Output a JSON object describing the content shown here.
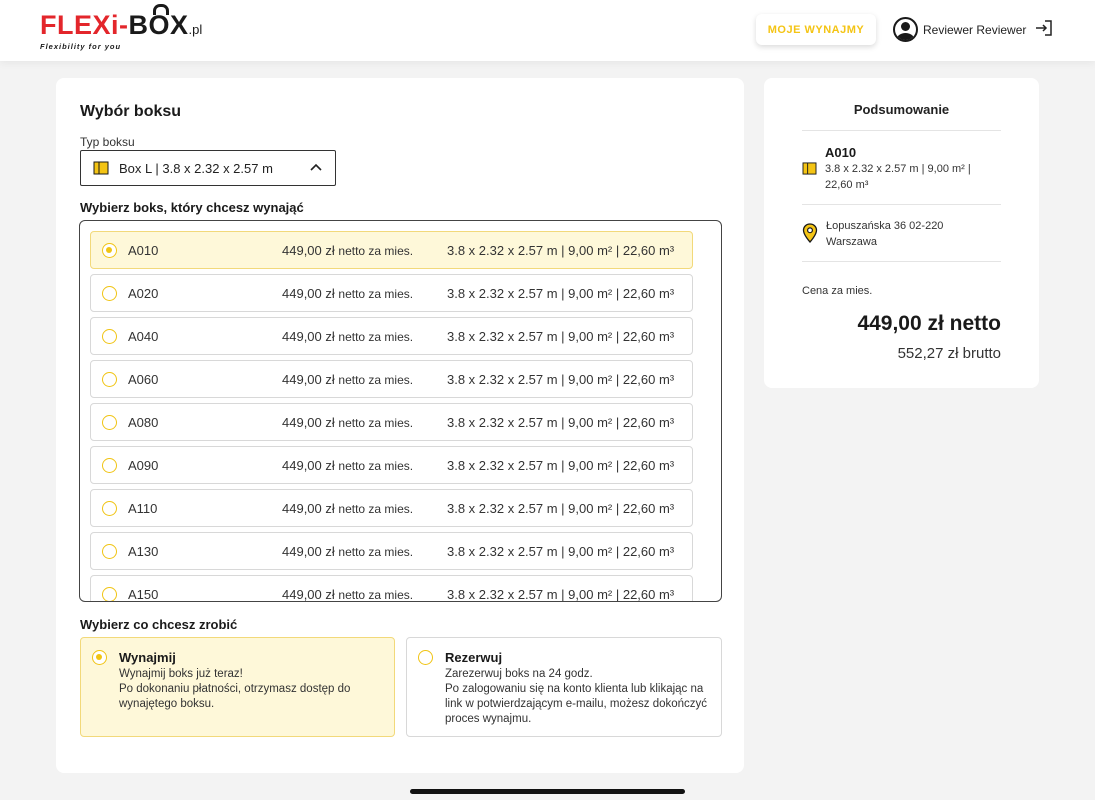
{
  "header": {
    "logo_part1": "FLEXi",
    "logo_dash": "-",
    "logo_part2_pre": "B",
    "logo_part2_o": "O",
    "logo_part2_post": "X",
    "logo_pl": ".pl",
    "tagline": "Flexibility for you",
    "rentals_button": "MOJE WYNAJMY",
    "user_name": "Reviewer Reviewer"
  },
  "main": {
    "title": "Wybór boksu",
    "type_label": "Typ boksu",
    "type_value": "Box L | 3.8 x 2.32 x 2.57 m",
    "choose_label": "Wybierz boks, który chcesz wynająć",
    "boxes": [
      {
        "code": "A010",
        "price": "449,00 zł",
        "price_unit": "netto za mies.",
        "dims": "3.8 x 2.32 x 2.57 m | 9,00 m² | 22,60 m³",
        "selected": true
      },
      {
        "code": "A020",
        "price": "449,00 zł",
        "price_unit": "netto za mies.",
        "dims": "3.8 x 2.32 x 2.57 m | 9,00 m² | 22,60 m³",
        "selected": false
      },
      {
        "code": "A040",
        "price": "449,00 zł",
        "price_unit": "netto za mies.",
        "dims": "3.8 x 2.32 x 2.57 m | 9,00 m² | 22,60 m³",
        "selected": false
      },
      {
        "code": "A060",
        "price": "449,00 zł",
        "price_unit": "netto za mies.",
        "dims": "3.8 x 2.32 x 2.57 m | 9,00 m² | 22,60 m³",
        "selected": false
      },
      {
        "code": "A080",
        "price": "449,00 zł",
        "price_unit": "netto za mies.",
        "dims": "3.8 x 2.32 x 2.57 m | 9,00 m² | 22,60 m³",
        "selected": false
      },
      {
        "code": "A090",
        "price": "449,00 zł",
        "price_unit": "netto za mies.",
        "dims": "3.8 x 2.32 x 2.57 m | 9,00 m² | 22,60 m³",
        "selected": false
      },
      {
        "code": "A110",
        "price": "449,00 zł",
        "price_unit": "netto za mies.",
        "dims": "3.8 x 2.32 x 2.57 m | 9,00 m² | 22,60 m³",
        "selected": false
      },
      {
        "code": "A130",
        "price": "449,00 zł",
        "price_unit": "netto za mies.",
        "dims": "3.8 x 2.32 x 2.57 m | 9,00 m² | 22,60 m³",
        "selected": false
      },
      {
        "code": "A150",
        "price": "449,00 zł",
        "price_unit": "netto za mies.",
        "dims": "3.8 x 2.32 x 2.57 m | 9,00 m² | 22,60 m³",
        "selected": false
      }
    ],
    "action_label": "Wybierz co chcesz zrobić",
    "options": [
      {
        "title": "Wynajmij",
        "desc_line1": "Wynajmij boks już teraz!",
        "desc_line2": "Po dokonaniu płatności, otrzymasz dostęp do wynajętego boksu.",
        "selected": true
      },
      {
        "title": "Rezerwuj",
        "desc_line1": "Zarezerwuj boks na 24 godz.",
        "desc_line2": "Po zalogowaniu się na konto klienta lub klikając na link w potwierdzającym e-mailu, możesz dokończyć proces wynajmu.",
        "selected": false
      }
    ]
  },
  "summary": {
    "title": "Podsumowanie",
    "code": "A010",
    "dims": "3.8 x 2.32 x 2.57 m | 9,00 m² | 22,60 m³",
    "address_line1": "Łopuszańska 36 02-220",
    "address_line2": "Warszawa",
    "price_label": "Cena za mies.",
    "price_net": "449,00 zł netto",
    "price_gross": "552,27 zł brutto"
  },
  "colors": {
    "accent": "#f0c414",
    "selected_bg": "#fef8d9",
    "logo_red": "#e3262b"
  },
  "icons": {
    "box": "box-icon",
    "chevron": "chevron-up-icon",
    "pin": "location-pin-icon",
    "user": "user-avatar-icon",
    "logout": "logout-icon"
  }
}
